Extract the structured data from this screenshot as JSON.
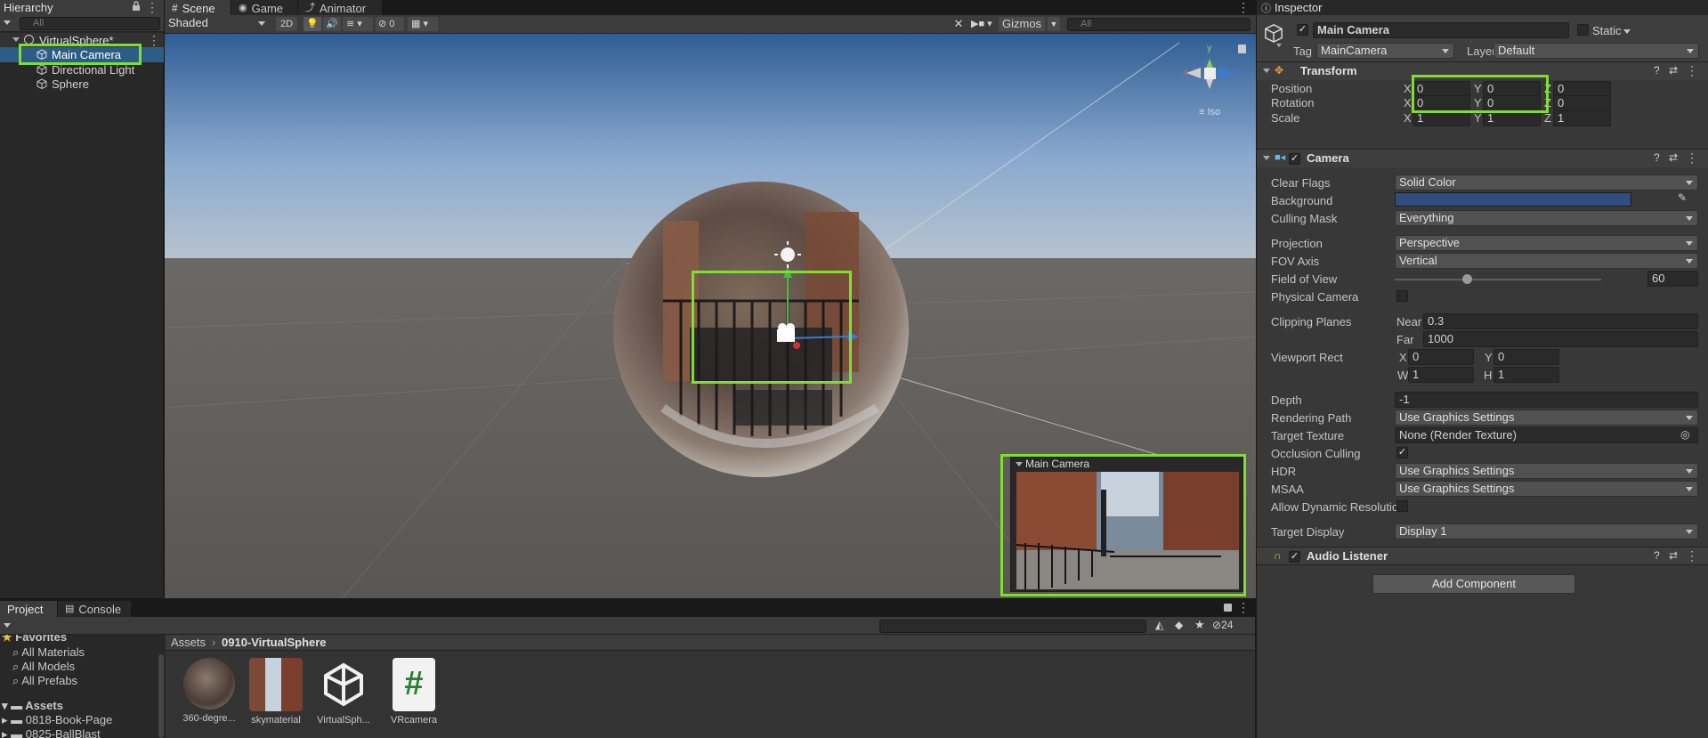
{
  "hierarchy": {
    "tab": "Hierarchy",
    "search_placeholder": "All",
    "scene_name": "VirtualSphere*",
    "items": [
      "Main Camera",
      "Directional Light",
      "Sphere"
    ]
  },
  "scene_view": {
    "tabs": [
      "Scene",
      "Game",
      "Animator"
    ],
    "shading_mode": "Shaded",
    "mode_2d": "2D",
    "hidden_count": "0",
    "gizmos_label": "Gizmos",
    "search_placeholder": "All",
    "gizmo_axes": {
      "y": "y",
      "x": "x",
      "z": "z"
    },
    "projection_label": "Iso",
    "camera_preview_title": "Main Camera"
  },
  "inspector": {
    "tab": "Inspector",
    "object_name": "Main Camera",
    "static_label": "Static",
    "tag_label": "Tag",
    "tag_value": "MainCamera",
    "layer_label": "Layer",
    "layer_value": "Default",
    "transform": {
      "title": "Transform",
      "position_label": "Position",
      "position": {
        "x": "0",
        "y": "0",
        "z": "0"
      },
      "rotation_label": "Rotation",
      "rotation": {
        "x": "0",
        "y": "0",
        "z": "0"
      },
      "scale_label": "Scale",
      "scale": {
        "x": "1",
        "y": "1",
        "z": "1"
      }
    },
    "camera": {
      "title": "Camera",
      "clear_flags_label": "Clear Flags",
      "clear_flags": "Solid Color",
      "background_label": "Background",
      "background_color": "#2f4d7d",
      "culling_mask_label": "Culling Mask",
      "culling_mask": "Everything",
      "projection_label": "Projection",
      "projection": "Perspective",
      "fov_axis_label": "FOV Axis",
      "fov_axis": "Vertical",
      "fov_label": "Field of View",
      "fov": "60",
      "fov_slider_fraction": 0.35,
      "physical_camera_label": "Physical Camera",
      "clipping_label": "Clipping Planes",
      "near_label": "Near",
      "near": "0.3",
      "far_label": "Far",
      "far": "1000",
      "viewport_label": "Viewport Rect",
      "vx_label": "X",
      "vx": "0",
      "vy_label": "Y",
      "vy": "0",
      "vw_label": "W",
      "vw": "1",
      "vh_label": "H",
      "vh": "1",
      "depth_label": "Depth",
      "depth": "-1",
      "rendering_path_label": "Rendering Path",
      "rendering_path": "Use Graphics Settings",
      "target_texture_label": "Target Texture",
      "target_texture": "None (Render Texture)",
      "occlusion_label": "Occlusion Culling",
      "hdr_label": "HDR",
      "hdr": "Use Graphics Settings",
      "msaa_label": "MSAA",
      "msaa": "Use Graphics Settings",
      "dynamic_res_label": "Allow Dynamic Resolution",
      "target_display_label": "Target Display",
      "target_display": "Display 1"
    },
    "audio_listener": {
      "title": "Audio Listener"
    },
    "add_component": "Add Component"
  },
  "project": {
    "tabs": [
      "Project",
      "Console"
    ],
    "favorites_label": "Favorites",
    "favorites": [
      "All Materials",
      "All Models",
      "All Prefabs"
    ],
    "assets_label": "Assets",
    "folders": [
      "0818-Book-Page",
      "0825-BallBlast"
    ],
    "breadcrumb": [
      "Assets",
      "0910-VirtualSphere"
    ],
    "hidden_count": "24",
    "assets": [
      {
        "name": "360-degre...",
        "icon": "sphere-thumbnail"
      },
      {
        "name": "skymaterial",
        "icon": "street-thumbnail"
      },
      {
        "name": "VirtualSph...",
        "icon": "unity-logo-icon"
      },
      {
        "name": "VRcamera",
        "icon": "csharp-script-icon"
      }
    ]
  }
}
